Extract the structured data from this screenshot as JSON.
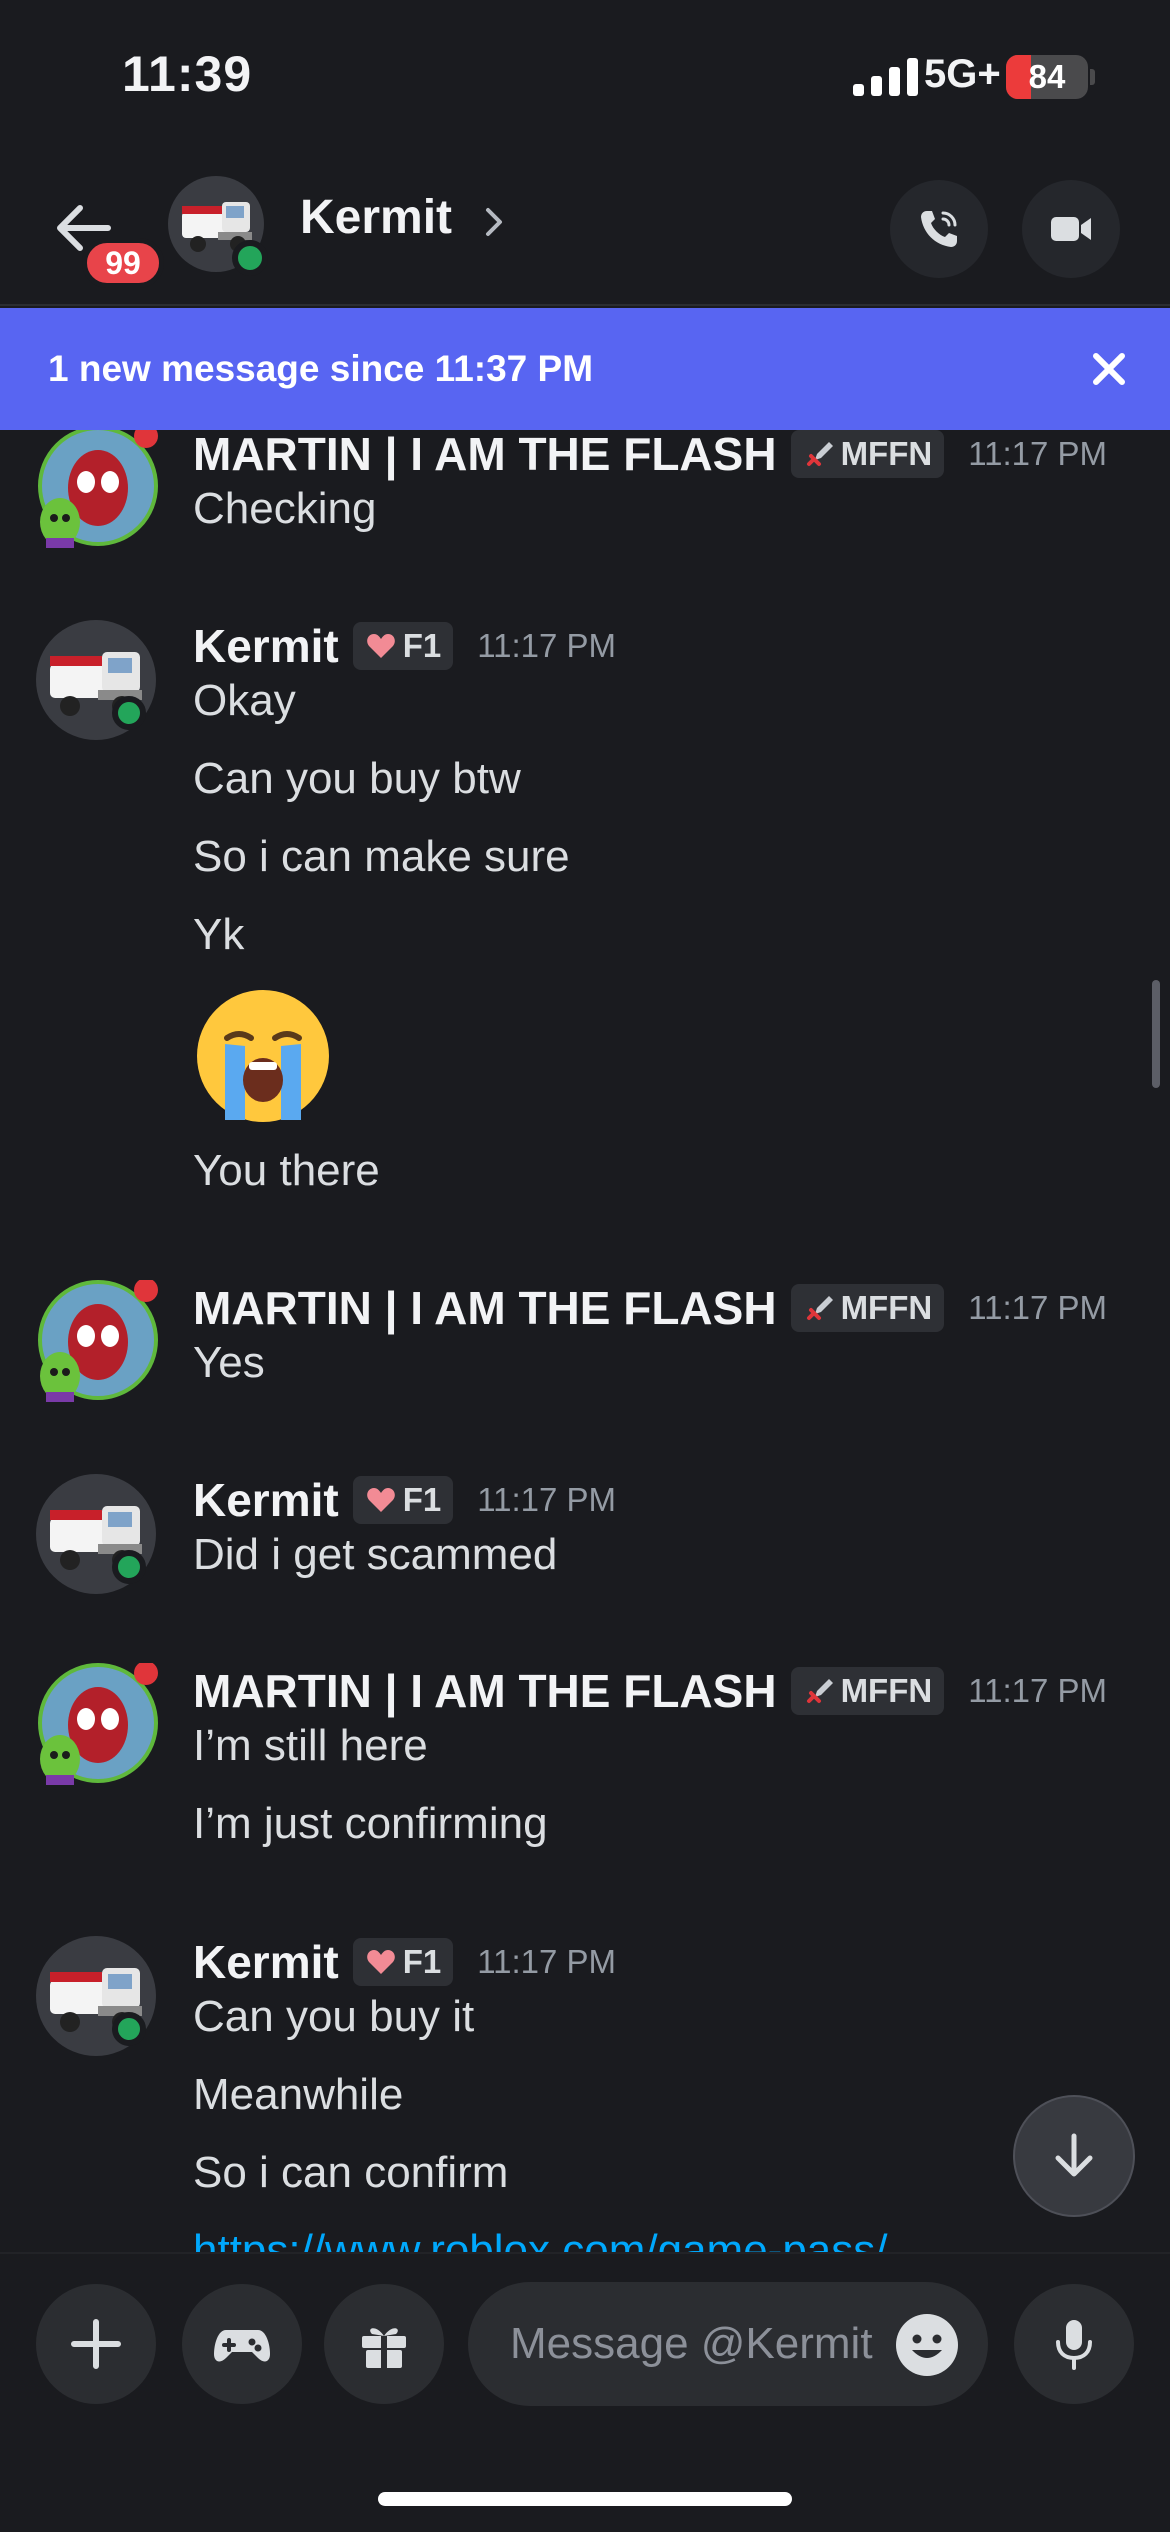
{
  "status_bar": {
    "time": "11:39",
    "network": "5G+",
    "battery": "84",
    "battery_level_percent": 30
  },
  "header": {
    "unread_count": "99",
    "name": "Kermit"
  },
  "banner": {
    "text": "1 new message since 11:37 PM"
  },
  "messages": [
    {
      "author": "MARTIN | I AM THE FLASH",
      "tag": "MFFN",
      "tag_icon": "sword-icon",
      "time": "11:17 PM",
      "lines": [
        "Checking"
      ]
    },
    {
      "author": "Kermit",
      "tag": "F1",
      "tag_icon": "heart-icon",
      "time": "11:17 PM",
      "lines": [
        "Okay",
        "Can you buy btw",
        "So i can make sure",
        "Yk",
        "You there"
      ],
      "emoji": "loudly-crying-face"
    },
    {
      "author": "MARTIN | I AM THE FLASH",
      "tag": "MFFN",
      "tag_icon": "sword-icon",
      "time": "11:17 PM",
      "lines": [
        "Yes"
      ]
    },
    {
      "author": "Kermit",
      "tag": "F1",
      "tag_icon": "heart-icon",
      "time": "11:17 PM",
      "lines": [
        "Did i get scammed"
      ]
    },
    {
      "author": "MARTIN | I AM THE FLASH",
      "tag": "MFFN",
      "tag_icon": "sword-icon",
      "time": "11:17 PM",
      "lines": [
        "I’m still here",
        "I’m just confirming"
      ]
    },
    {
      "author": "Kermit",
      "tag": "F1",
      "tag_icon": "heart-icon",
      "time": "11:17 PM",
      "lines": [
        "Can you buy it",
        "Meanwhile",
        "So i can confirm"
      ],
      "link": "https://www.roblox.com/game-pass/"
    }
  ],
  "composer": {
    "placeholder": "Message @Kermit"
  },
  "colors": {
    "accent": "#5865f2",
    "background": "#1a1b1f",
    "online": "#23a55a",
    "badge": "#e8444a",
    "link": "#00a8fc"
  }
}
